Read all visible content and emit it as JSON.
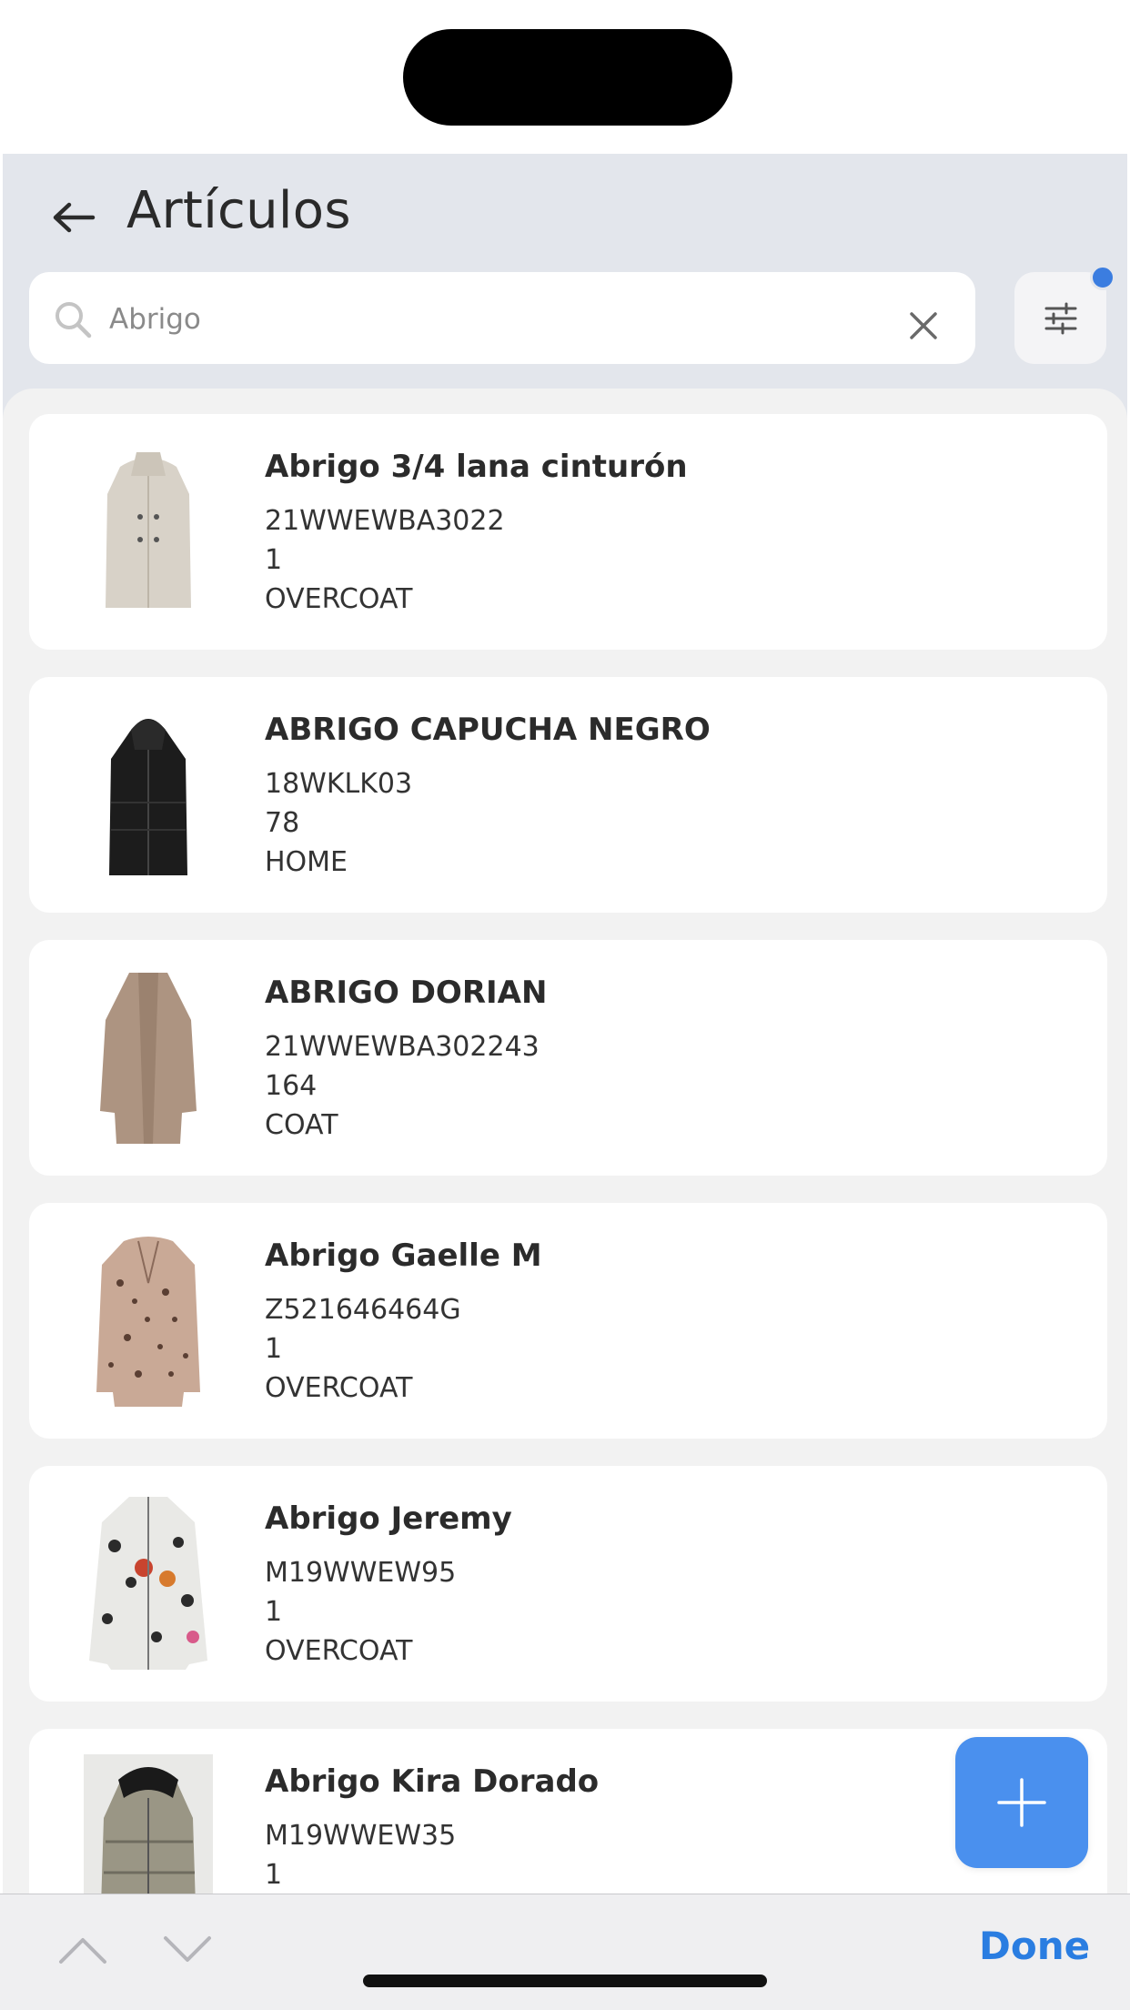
{
  "header": {
    "title": "Artículos",
    "back_icon": "arrow-left-icon"
  },
  "search": {
    "value": "Abrigo",
    "placeholder": "Abrigo",
    "search_icon": "search-icon",
    "clear_icon": "close-icon"
  },
  "filter": {
    "icon": "sliders-icon",
    "badge_color": "#3b7de0"
  },
  "items": [
    {
      "name": "Abrigo 3/4 lana cinturón",
      "code": "21WWEWBA3022",
      "quantity": "1",
      "category": "OVERCOAT",
      "image": "coat-beige-thumbnail"
    },
    {
      "name": "ABRIGO CAPUCHA NEGRO",
      "code": "18WKLK03",
      "quantity": "78",
      "category": "HOME",
      "image": "coat-black-hood-thumbnail"
    },
    {
      "name": "ABRIGO DORIAN",
      "code": "21WWEWBA302243",
      "quantity": "164",
      "category": "COAT",
      "image": "coat-camel-long-thumbnail"
    },
    {
      "name": "Abrigo Gaelle M",
      "code": "Z521646464G",
      "quantity": "1",
      "category": "OVERCOAT",
      "image": "blazer-leopard-thumbnail"
    },
    {
      "name": "Abrigo Jeremy",
      "code": "M19WWEW95",
      "quantity": "1",
      "category": "OVERCOAT",
      "image": "jacket-print-thumbnail"
    },
    {
      "name": "Abrigo Kira Dorado",
      "code": "M19WWEW35",
      "quantity": "1",
      "category": "",
      "image": "puffer-gold-thumbnail"
    }
  ],
  "fab": {
    "icon": "plus-icon",
    "color": "#4a90ee"
  },
  "keyboard_toolbar": {
    "prev_icon": "chevron-up-icon",
    "next_icon": "chevron-down-icon",
    "done_label": "Done",
    "done_color": "#2a7de1"
  }
}
